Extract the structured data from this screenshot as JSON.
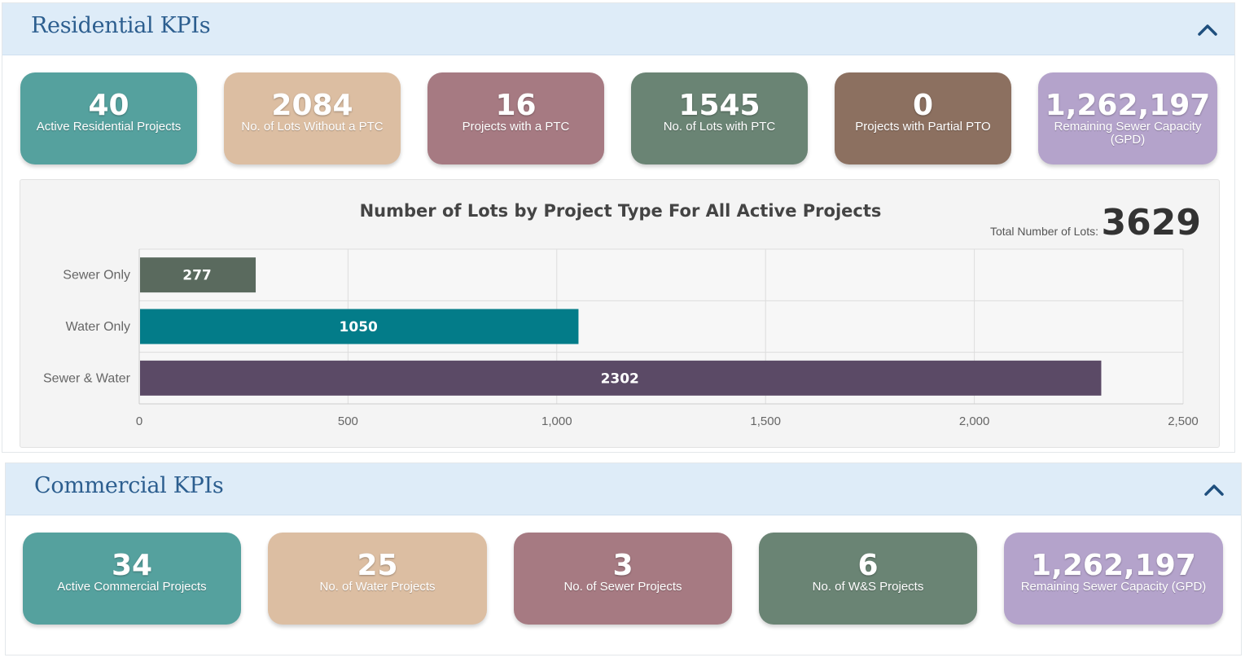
{
  "residential": {
    "title": "Residential KPIs",
    "kpis": [
      {
        "value": "40",
        "label": "Active Residential Projects",
        "color": "#55a19e"
      },
      {
        "value": "2084",
        "label": "No. of Lots Without a PTC",
        "color": "#dcbea2"
      },
      {
        "value": "16",
        "label": "Projects with a PTC",
        "color": "#a67a82"
      },
      {
        "value": "1545",
        "label": "No. of Lots with PTC",
        "color": "#6a8474"
      },
      {
        "value": "0",
        "label": "Projects with Partial PTO",
        "color": "#8c7060"
      },
      {
        "value": "1,262,197",
        "label": "Remaining Sewer Capacity (GPD)",
        "color": "#b4a3cb"
      }
    ]
  },
  "chart": {
    "title": "Number of Lots by Project Type For All Active Projects",
    "total_label": "Total Number of Lots:",
    "total_value": "3629"
  },
  "chart_data": {
    "type": "bar",
    "orientation": "horizontal",
    "title": "Number of Lots by Project Type For All Active Projects",
    "categories": [
      "Sewer Only",
      "Water Only",
      "Sewer & Water"
    ],
    "values": [
      277,
      1050,
      2302
    ],
    "colors": [
      "#5a6a5e",
      "#037c89",
      "#5b4a66"
    ],
    "data_labels": [
      "277",
      "1050",
      "2302"
    ],
    "xlim": [
      0,
      2500
    ],
    "xticks": [
      0,
      500,
      1000,
      1500,
      2000,
      2500
    ],
    "xtick_labels": [
      "0",
      "500",
      "1,000",
      "1,500",
      "2,000",
      "2,500"
    ],
    "grid": true
  },
  "commercial": {
    "title": "Commercial KPIs",
    "kpis": [
      {
        "value": "34",
        "label": "Active Commercial Projects",
        "color": "#55a19e"
      },
      {
        "value": "25",
        "label": "No. of Water Projects",
        "color": "#dcbea2"
      },
      {
        "value": "3",
        "label": "No. of Sewer Projects",
        "color": "#a67a82"
      },
      {
        "value": "6",
        "label": "No. of W&S Projects",
        "color": "#6a8474"
      },
      {
        "value": "1,262,197",
        "label": "Remaining Sewer Capacity (GPD)",
        "color": "#b4a3cb"
      }
    ]
  }
}
